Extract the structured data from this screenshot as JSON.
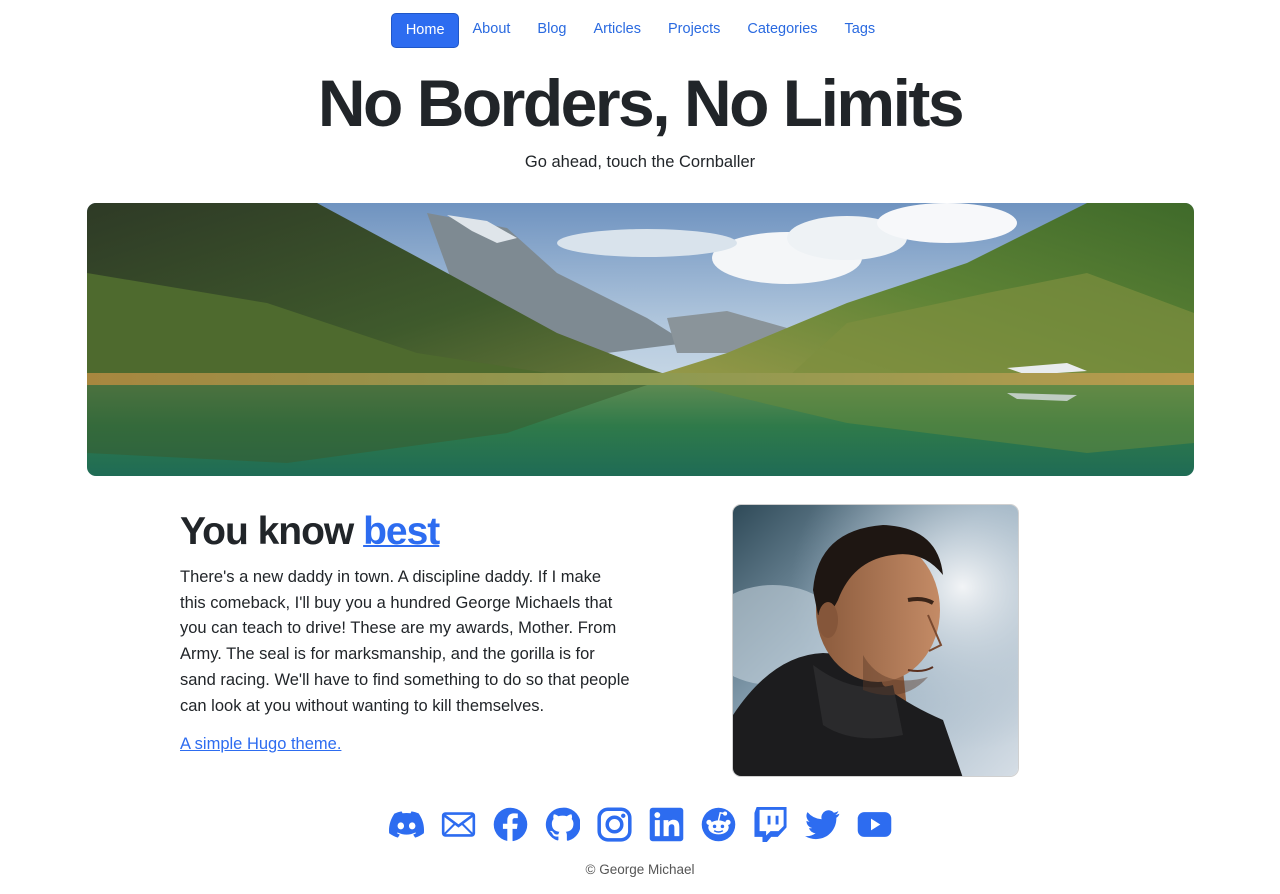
{
  "nav": {
    "items": [
      {
        "label": "Home",
        "active": true
      },
      {
        "label": "About"
      },
      {
        "label": "Blog"
      },
      {
        "label": "Articles"
      },
      {
        "label": "Projects"
      },
      {
        "label": "Categories"
      },
      {
        "label": "Tags"
      }
    ]
  },
  "header": {
    "title": "No Borders, No Limits",
    "subtitle": "Go ahead, touch the Cornballer"
  },
  "content": {
    "heading_prefix": "You know ",
    "heading_link": "best",
    "body": "There's a new daddy in town. A discipline daddy. If I make this comeback, I'll buy you a hundred George Michaels that you can teach to drive! These are my awards, Mother. From Army. The seal is for marksmanship, and the gorilla is for sand racing. We'll have to find something to do so that people can look at you without wanting to kill themselves.",
    "link": "A simple Hugo theme."
  },
  "social": {
    "icons": [
      "discord-icon",
      "email-icon",
      "facebook-icon",
      "github-icon",
      "instagram-icon",
      "linkedin-icon",
      "reddit-icon",
      "twitch-icon",
      "twitter-icon",
      "youtube-icon"
    ]
  },
  "footer": {
    "copyright": "© George Michael"
  },
  "colors": {
    "accent": "#2d6cf0",
    "text": "#212529"
  }
}
